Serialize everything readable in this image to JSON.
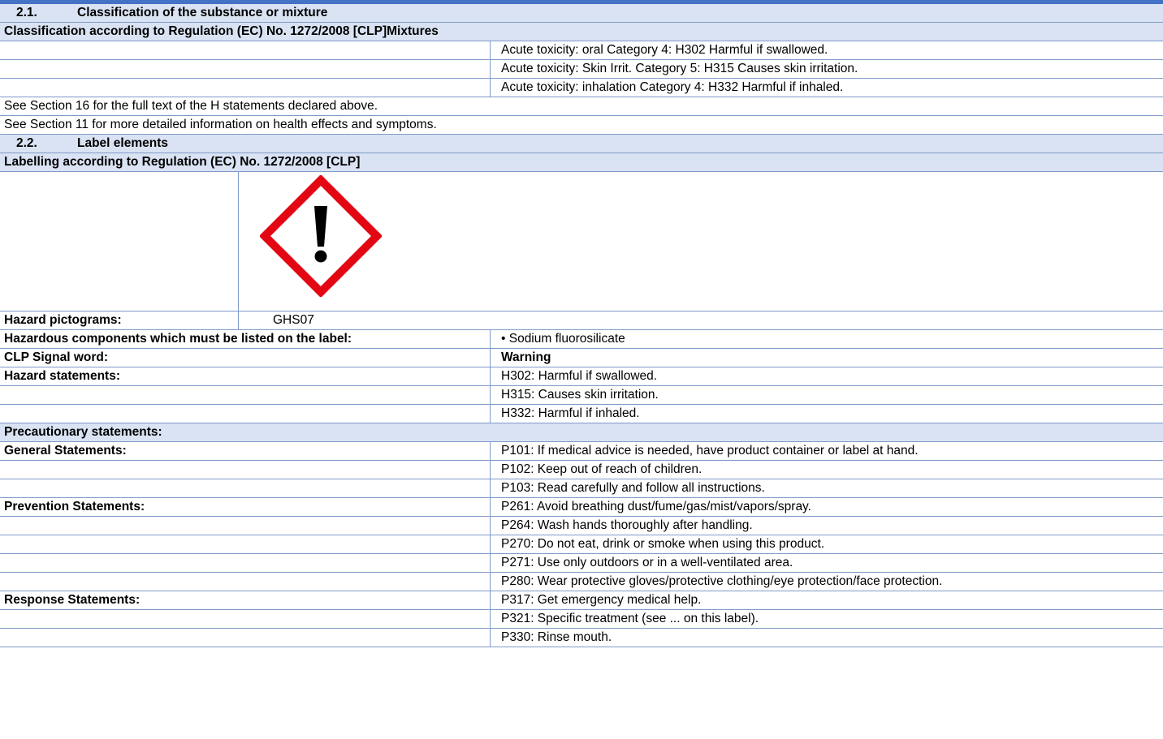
{
  "s21": {
    "number": "2.1.",
    "title": "Classification of the substance or mixture",
    "subheader": "Classification according to Regulation (EC) No. 1272/2008 [CLP]Mixtures",
    "classifications": [
      "Acute toxicity: oral Category 4: H302 Harmful if swallowed.",
      "Acute toxicity: Skin Irrit. Category 5: H315 Causes skin irritation.",
      "Acute toxicity: inhalation Category 4: H332 Harmful if inhaled."
    ],
    "note1": "See Section 16 for the full text of the H statements declared above.",
    "note2": "See Section 11 for more detailed information on health effects and symptoms."
  },
  "s22": {
    "number": "2.2.",
    "title": "Label elements",
    "subheader": "Labelling according to Regulation (EC) No. 1272/2008 [CLP]",
    "pictogram_icon": "ghs07-exclamation-icon",
    "pictogram_color": "#e30613",
    "hazard_pictograms_label": "Hazard pictograms:",
    "hazard_pictograms_value": "GHS07",
    "hazardous_components_label": "Hazardous components which must be listed on the label:",
    "hazardous_components_value": "• Sodium fluorosilicate",
    "signal_word_label": "CLP Signal word:",
    "signal_word_value": "Warning",
    "hazard_statements_label": "Hazard statements:",
    "hazard_statements": [
      "H302: Harmful if swallowed.",
      "H315: Causes skin irritation.",
      "H332: Harmful if inhaled."
    ],
    "precautionary_label": "Precautionary statements:",
    "general_label": "General Statements:",
    "general": [
      "P101: If medical advice is needed, have product container or label at hand.",
      "P102: Keep out of reach of children.",
      "P103: Read carefully and follow all instructions."
    ],
    "prevention_label": "Prevention Statements:",
    "prevention": [
      "P261: Avoid breathing dust/fume/gas/mist/vapors/spray.",
      "P264: Wash hands thoroughly after handling.",
      "P270: Do not eat, drink or smoke when using this product.",
      "P271: Use only outdoors or in a well-ventilated area.",
      "P280: Wear protective gloves/protective clothing/eye protection/face protection."
    ],
    "response_label": "Response Statements:",
    "response": [
      "P317: Get emergency medical help.",
      "P321: Specific treatment (see ... on this label).",
      "P330: Rinse mouth."
    ]
  }
}
